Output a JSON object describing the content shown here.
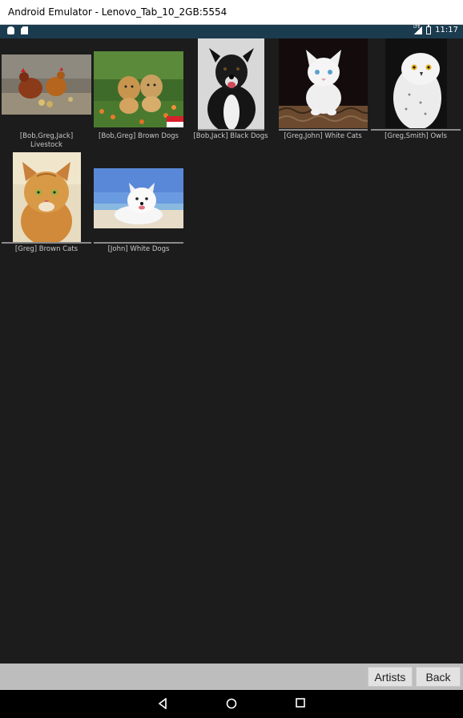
{
  "window": {
    "title": "Android Emulator - Lenovo_Tab_10_2GB:5554"
  },
  "status_bar": {
    "time": "11:17",
    "network": "LTE"
  },
  "gallery": {
    "items": [
      {
        "caption": "[Bob,Greg,Jack] Livestock",
        "caption_line1": "[Bob,Greg,Jack]",
        "caption_line2": "Livestock",
        "subject": "chickens"
      },
      {
        "caption": "[Bob,Greg] Brown Dogs",
        "subject": "brown puppies",
        "flag": "red-white"
      },
      {
        "caption": "[Bob,Jack] Black Dogs",
        "subject": "black dog"
      },
      {
        "caption": "[Greg,John] White Cats",
        "subject": "white kitten"
      },
      {
        "caption": "[Greg,Smith] Owls",
        "subject": "snowy owl"
      },
      {
        "caption": "[Greg] Brown Cats",
        "subject": "orange cat"
      },
      {
        "caption": "[John] White Dogs",
        "subject": "white dog on beach"
      }
    ]
  },
  "actions": {
    "artists": "Artists",
    "back": "Back"
  }
}
